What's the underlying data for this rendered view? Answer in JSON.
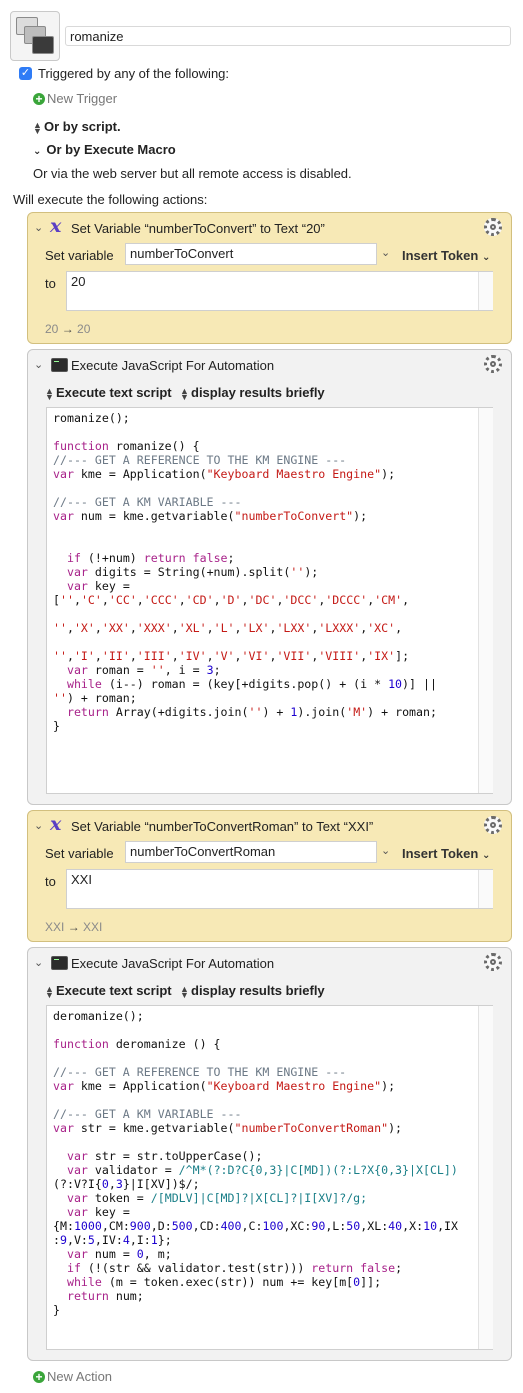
{
  "macro": {
    "name": "romanize"
  },
  "triggers": {
    "checkbox_label": "Triggered by any of the following:",
    "new_trigger": "New Trigger",
    "or_by_script": "Or by script.",
    "or_by_execute_macro": "Or by Execute Macro",
    "web_server_note": "Or via the web server but all remote access is disabled."
  },
  "will_execute": "Will execute the following actions:",
  "actions": [
    {
      "title": "Set Variable “numberToConvert” to Text “20”",
      "set_variable_label": "Set variable",
      "variable_name": "numberToConvert",
      "insert_token": "Insert Token",
      "to_label": "to",
      "to_value": "20",
      "preview_from": "20",
      "preview_to": "20"
    },
    {
      "title": "Execute JavaScript For Automation",
      "mode": "Execute text script",
      "results": "display results briefly"
    },
    {
      "title": "Set Variable “numberToConvertRoman” to Text “XXI”",
      "set_variable_label": "Set variable",
      "variable_name": "numberToConvertRoman",
      "insert_token": "Insert Token",
      "to_label": "to",
      "to_value": "XXI",
      "preview_from": "XXI",
      "preview_to": "XXI"
    },
    {
      "title": "Execute JavaScript For Automation",
      "mode": "Execute text script",
      "results": "display results briefly"
    }
  ],
  "scripts": {
    "romanize": [
      "romanize();",
      "",
      "function romanize() {",
      "//--- GET A REFERENCE TO THE KM ENGINE ---",
      "var kme = Application(\"Keyboard Maestro Engine\");",
      "",
      "//--- GET A KM VARIABLE ---",
      "var num = kme.getvariable(\"numberToConvert\");",
      "",
      "",
      "  if (!+num) return false;",
      "  var digits = String(+num).split('');",
      "  var key =",
      "['','C','CC','CCC','CD','D','DC','DCC','DCCC','CM',",
      "",
      "'','X','XX','XXX','XL','L','LX','LXX','LXXX','XC',",
      "",
      "'','I','II','III','IV','V','VI','VII','VIII','IX'];",
      "  var roman = '', i = 3;",
      "  while (i--) roman = (key[+digits.pop() + (i * 10)] ||",
      "'') + roman;",
      "  return Array(+digits.join('') + 1).join('M') + roman;",
      "}"
    ],
    "deromanize": [
      "deromanize();",
      "",
      "function deromanize () {",
      "",
      "//--- GET A REFERENCE TO THE KM ENGINE ---",
      "var kme = Application(\"Keyboard Maestro Engine\");",
      "",
      "//--- GET A KM VARIABLE ---",
      "var str = kme.getvariable(\"numberToConvertRoman\");",
      "",
      "  var str = str.toUpperCase();",
      "  var validator = /^M*(?:D?C{0,3}|C[MD])(?:L?X{0,3}|X[CL])",
      "(?:V?I{0,3}|I[XV])$/;",
      "  var token = /[MDLV]|C[MD]?|X[CL]?|I[XV]?/g;",
      "  var key =",
      "{M:1000,CM:900,D:500,CD:400,C:100,XC:90,L:50,XL:40,X:10,IX",
      ":9,V:5,IV:4,I:1};",
      "  var num = 0, m;",
      "  if (!(str && validator.test(str))) return false;",
      "  while (m = token.exec(str)) num += key[m[0]];",
      "  return num;",
      "}"
    ]
  },
  "new_action": "New Action",
  "icons": [
    "macro-icon",
    "checkbox-icon",
    "plus-icon",
    "chevron-down-icon",
    "up-down-icon",
    "variable-x-icon",
    "terminal-icon",
    "gear-icon",
    "arrow-right-icon"
  ],
  "colors": {
    "yellow_action": "#f7e9b6",
    "gray_action": "#f2f2f2",
    "checkbox": "#2f7cf6",
    "plus": "#3aa53a"
  }
}
